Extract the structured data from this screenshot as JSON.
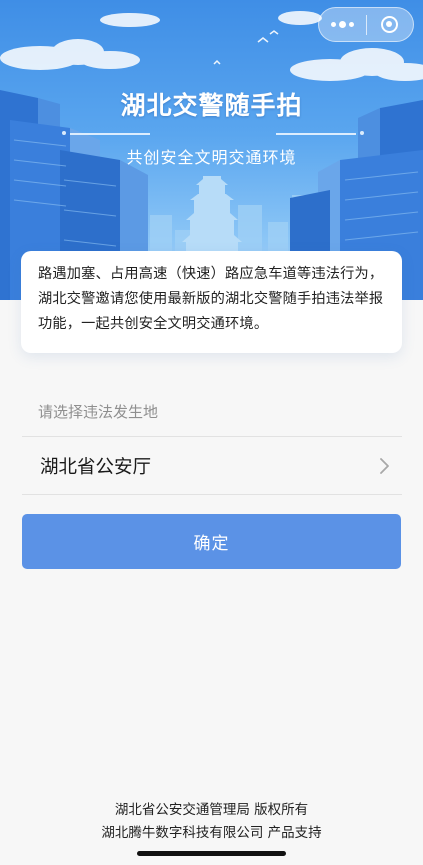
{
  "hero": {
    "title": "湖北交警随手拍",
    "subtitle": "共创安全文明交通环境"
  },
  "capsule": {
    "menu_icon": "more-dots-icon",
    "close_icon": "close-circle-icon"
  },
  "notice": {
    "text": "路遇加塞、占用高速（快速）路应急车道等违法行为，湖北交警邀请您使用最新版的湖北交警随手拍违法举报功能，一起共创安全文明交通环境。"
  },
  "location_select": {
    "hint": "请选择违法发生地",
    "value": "湖北省公安厅",
    "chevron_icon": "chevron-right-icon"
  },
  "confirm_button": {
    "label": "确定"
  },
  "footer": {
    "copyright": "湖北省公安交通管理局 版权所有",
    "support": "湖北腾牛数字科技有限公司 产品支持"
  },
  "colors": {
    "hero_top": "#3f8ee6",
    "primary_button": "#5b92e6",
    "background": "#f7f7f7"
  }
}
